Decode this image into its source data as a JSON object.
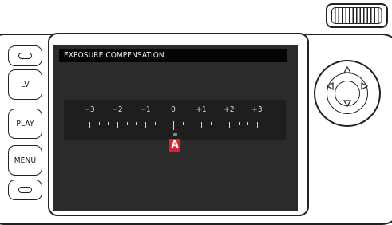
{
  "screen": {
    "title": "EXPOSURE COMPENSATION",
    "scale": {
      "labels": [
        "−3",
        "−2",
        "−1",
        "0",
        "+1",
        "+2",
        "+3"
      ],
      "min": -3,
      "max": 3,
      "step": 0.333,
      "current_value": 0
    },
    "marker_label": "A"
  },
  "buttons": {
    "lv": "LV",
    "play": "PLAY",
    "menu": "MENU"
  },
  "icons": {
    "top_dial": "thumbwheel-icon",
    "nav_up": "arrow-up-icon",
    "nav_down": "arrow-down-icon",
    "nav_left": "arrow-left-icon",
    "nav_right": "arrow-right-icon"
  },
  "colors": {
    "screen_bg": "#2b2b2b",
    "title_bg": "#050505",
    "marker": "#e0212b"
  }
}
